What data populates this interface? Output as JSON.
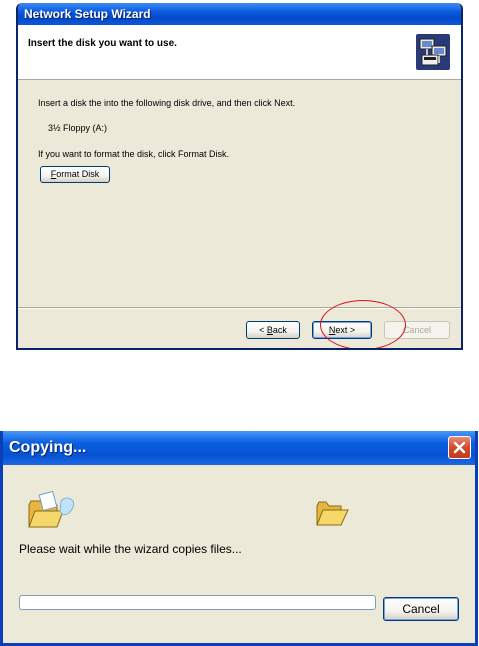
{
  "wizard": {
    "title": "Network Setup Wizard",
    "header_title": "Insert the disk you want to use.",
    "header_icon": "network-setup-icon",
    "instruction": "Insert a disk the into the following disk drive, and then click Next.",
    "drive": "3½ Floppy (A:)",
    "format_hint": "If you want to format the disk, click Format Disk.",
    "format_button": {
      "accel": "F",
      "rest": "ormat Disk"
    },
    "back_button": {
      "prefix": "< ",
      "accel": "B",
      "rest": "ack"
    },
    "next_button": {
      "accel": "N",
      "rest": "ext >"
    },
    "cancel_button": "Cancel",
    "next_enabled": true,
    "cancel_enabled": false
  },
  "copy_dialog": {
    "title": "Copying...",
    "close_icon": "close-icon",
    "source_icon": "folder-open-icon",
    "destination_icon": "folder-open-icon",
    "message": "Please wait while the wizard copies files...",
    "progress": 0,
    "cancel_button": "Cancel"
  },
  "colors": {
    "xp_title_blue": "#0a5bdc",
    "dialog_face": "#ece9d8",
    "highlight_ring": "#d8141e",
    "close_red": "#d34a2c"
  }
}
